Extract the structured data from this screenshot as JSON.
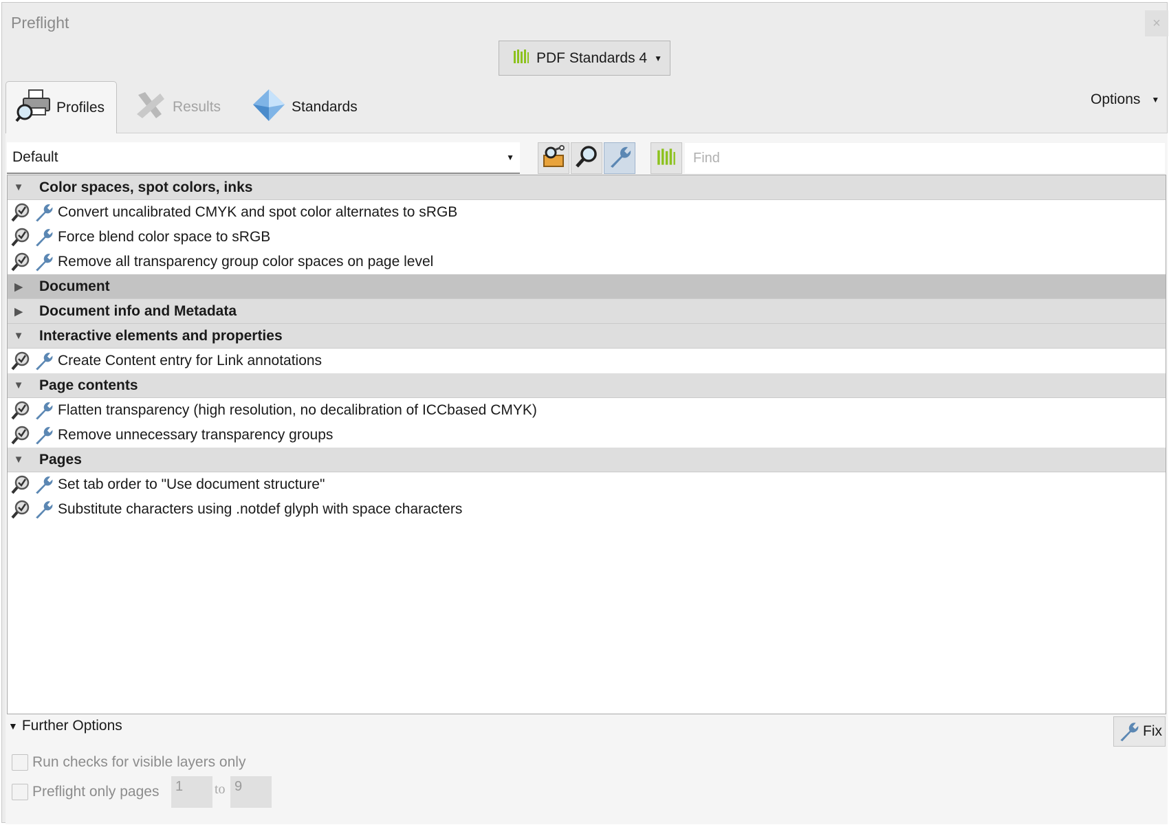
{
  "window": {
    "title": "Preflight",
    "close_glyph": "×"
  },
  "header": {
    "standards_button": {
      "label": "PDF Standards 4",
      "icon": "library-icon"
    }
  },
  "tabs": [
    {
      "label": "Profiles",
      "icon": "printer-magnifier-icon",
      "active": true
    },
    {
      "label": "Results",
      "icon": "results-x-icon",
      "active": false
    },
    {
      "label": "Standards",
      "icon": "diamond-icon",
      "active": false
    }
  ],
  "options": {
    "label": "Options"
  },
  "toolbar": {
    "profile_select": "Default",
    "buttons": [
      "edit-profiles-icon",
      "analyze-magnifier-icon",
      "fixup-wrench-icon",
      "library-icon"
    ],
    "find_placeholder": "Find"
  },
  "profiles": [
    {
      "category": "Color spaces, spot colors, inks",
      "expanded": true,
      "items": [
        "Convert uncalibrated CMYK and spot color alternates to sRGB",
        "Force blend color space to sRGB",
        "Remove all transparency group color spaces on page level"
      ]
    },
    {
      "category": "Document",
      "expanded": false,
      "selected": true,
      "items": []
    },
    {
      "category": "Document info and Metadata",
      "expanded": false,
      "items": []
    },
    {
      "category": "Interactive elements and properties",
      "expanded": true,
      "items": [
        "Create Content entry for Link annotations"
      ]
    },
    {
      "category": "Page contents",
      "expanded": true,
      "items": [
        "Flatten transparency (high resolution, no decalibration of ICCbased CMYK)",
        "Remove unnecessary transparency groups"
      ]
    },
    {
      "category": "Pages",
      "expanded": true,
      "items": [
        "Set tab order to \"Use document structure\"",
        "Substitute characters using .notdef glyph with space characters"
      ]
    }
  ],
  "further_options": {
    "label": "Further Options",
    "fix_button": "Fix",
    "visible_layers_label": "Run checks for visible layers only",
    "pages_label": "Preflight only pages",
    "page_from": "1",
    "to_label": "to",
    "page_to": "9"
  },
  "colors": {
    "accent_green": "#8dc21f",
    "wrench_blue": "#5b87b3",
    "selected_row": "#c3c3c3"
  }
}
